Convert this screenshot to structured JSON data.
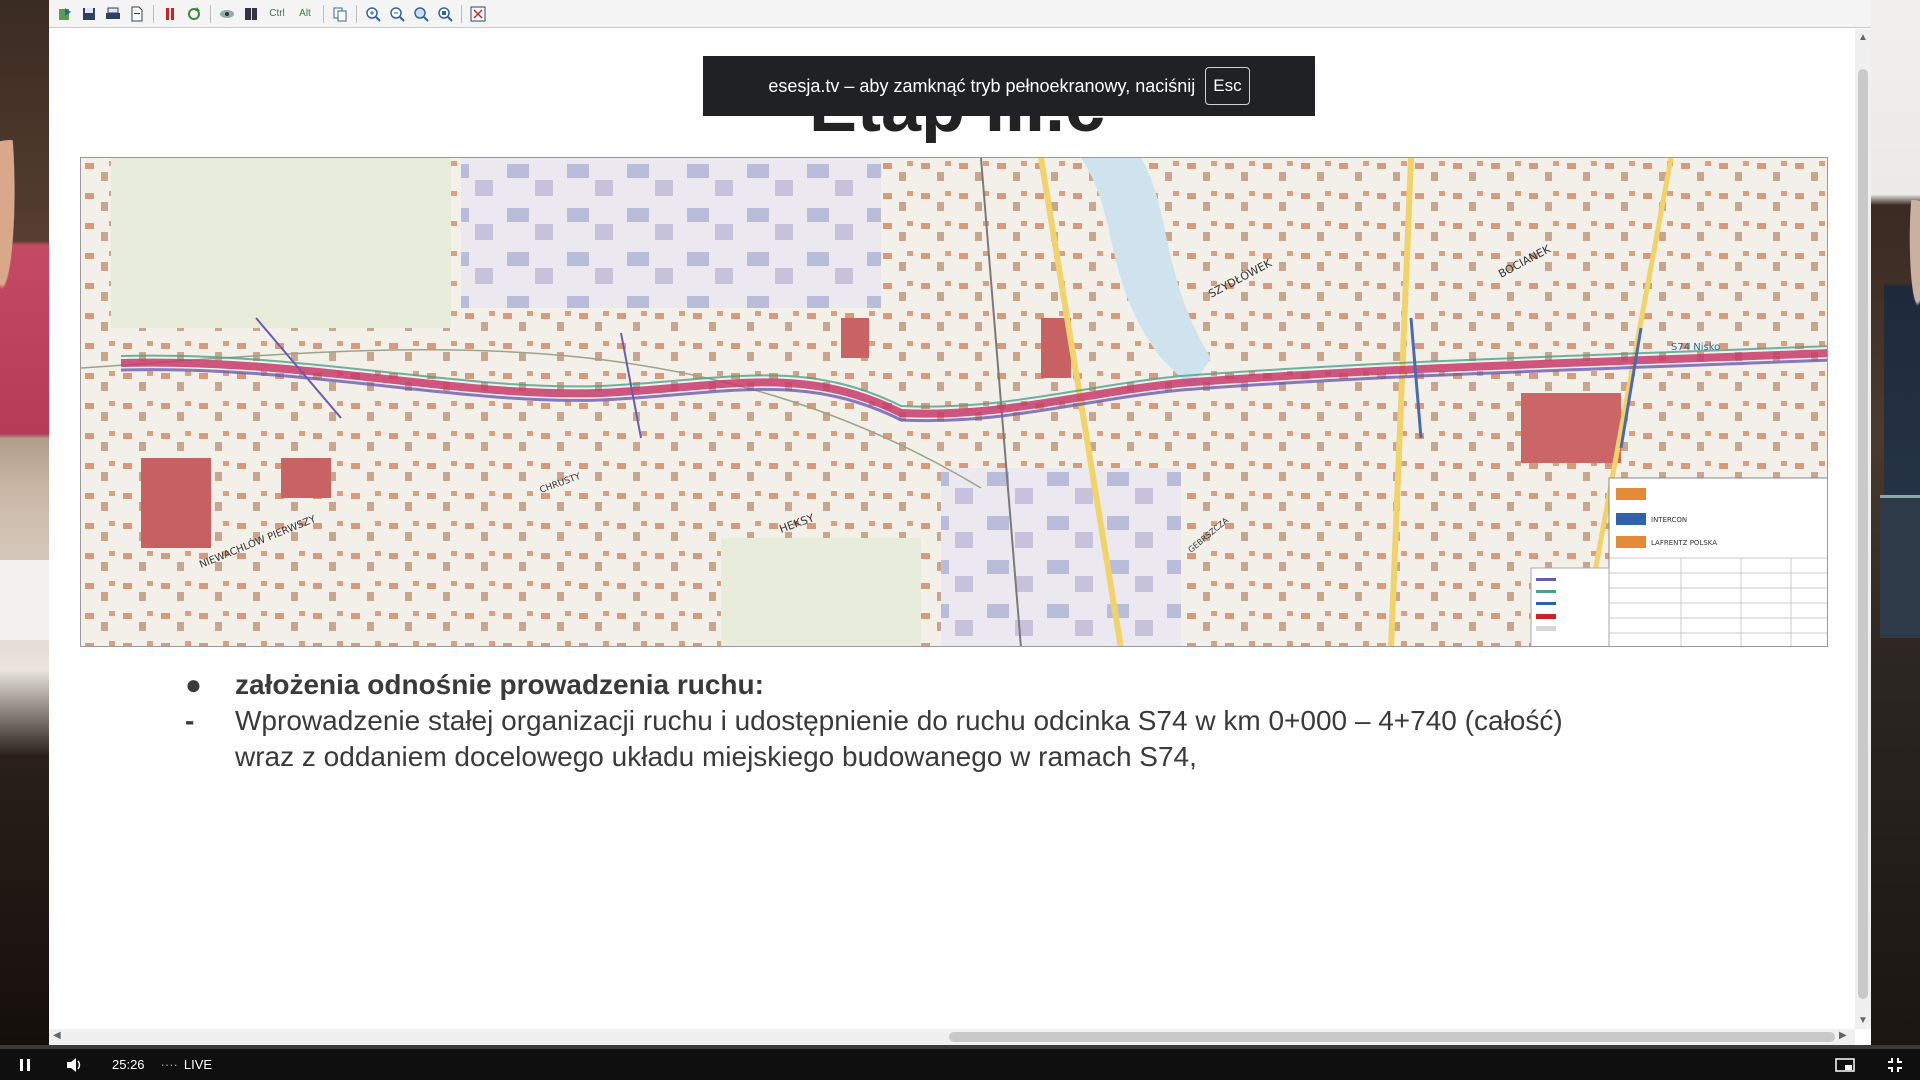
{
  "toolbar": {
    "buttons": [
      "export-icon",
      "save-icon",
      "print-icon",
      "document-icon",
      "pause-icon",
      "refresh-icon",
      "view-icon",
      "book-icon"
    ],
    "ctrl_label": "Ctrl",
    "alt_label": "Alt",
    "zoom": [
      "copy-icon",
      "zoom-in-icon",
      "zoom-out-icon",
      "zoom-fit-icon",
      "zoom-actual-icon",
      "fullscreen-icon"
    ]
  },
  "slide": {
    "title": "Etap III.c",
    "bullet_head": "założenia odnośnie prowadzenia ruchu:",
    "bullet_mark": "●",
    "dash_mark": "-",
    "bullet_line1": "Wprowadzenie stałej organizacji ruchu i udostępnienie do ruchu odcinka S74 w km 0+000 – 4+740 (całość)",
    "bullet_line2": "wraz z oddaniem docelowego układu miejskiego budowanego w ramach S74,"
  },
  "map": {
    "labels": [
      "SZYDŁÓWEK",
      "BOCIANEK",
      "S74 Nisko",
      "HEKSY",
      "CHRUSTY",
      "NIEWACHLÓW PIERWSZY",
      "GEBRSZCZA"
    ],
    "legend_titles": [
      "INTERCON",
      "LAFRENTZ POLSKA"
    ]
  },
  "notice": {
    "text": "esesja.tv – aby zamknąć tryb pełnoekranowy, naciśnij",
    "key": "Esc"
  },
  "player": {
    "time": "25:26",
    "live_label": "LIVE",
    "dots": "····"
  },
  "colors": {
    "road": "#c73a6b",
    "accent": "#2e63a8",
    "player_bg": "#0f0f0f"
  }
}
